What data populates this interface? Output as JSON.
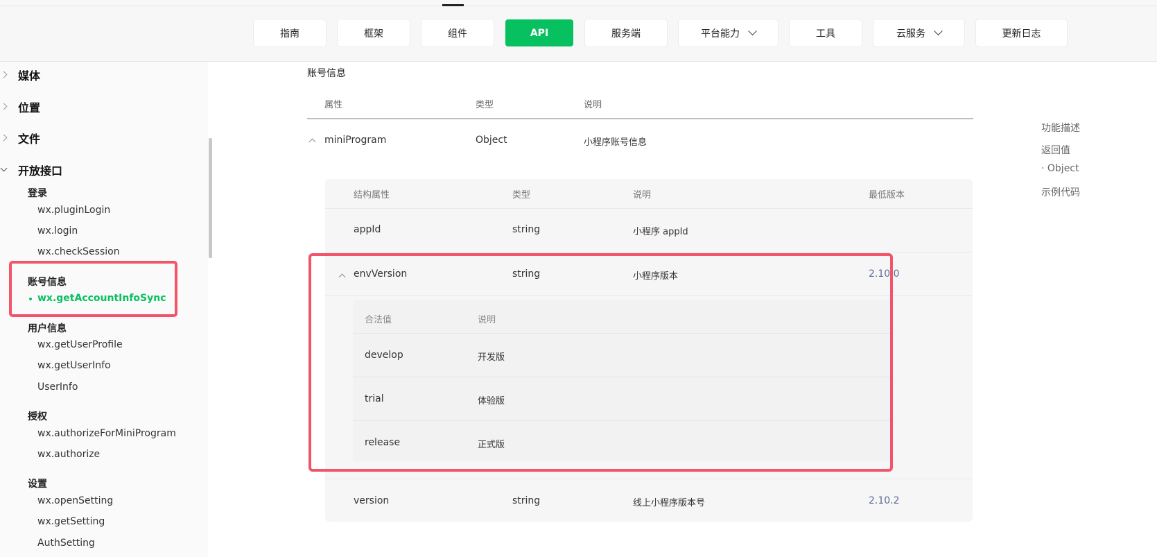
{
  "nav": {
    "items": [
      {
        "label": "指南",
        "active": false,
        "dropdown": false
      },
      {
        "label": "框架",
        "active": false,
        "dropdown": false
      },
      {
        "label": "组件",
        "active": false,
        "dropdown": false
      },
      {
        "label": "API",
        "active": true,
        "dropdown": false
      },
      {
        "label": "服务端",
        "active": false,
        "dropdown": false
      },
      {
        "label": "平台能力",
        "active": false,
        "dropdown": true
      },
      {
        "label": "工具",
        "active": false,
        "dropdown": false
      },
      {
        "label": "云服务",
        "active": false,
        "dropdown": true
      },
      {
        "label": "更新日志",
        "active": false,
        "dropdown": false
      }
    ]
  },
  "sidebar": {
    "categories": [
      {
        "label": "媒体",
        "expanded": false
      },
      {
        "label": "位置",
        "expanded": false
      },
      {
        "label": "文件",
        "expanded": false
      },
      {
        "label": "开放接口",
        "expanded": true
      }
    ],
    "groups": {
      "login": {
        "label": "登录",
        "items": [
          "wx.pluginLogin",
          "wx.login",
          "wx.checkSession"
        ]
      },
      "account": {
        "label": "账号信息",
        "items": [
          "wx.getAccountInfoSync"
        ]
      },
      "user": {
        "label": "用户信息",
        "items": [
          "wx.getUserProfile",
          "wx.getUserInfo",
          "UserInfo"
        ]
      },
      "auth": {
        "label": "授权",
        "items": [
          "wx.authorizeForMiniProgram",
          "wx.authorize"
        ]
      },
      "settings": {
        "label": "设置",
        "items": [
          "wx.openSetting",
          "wx.getSetting",
          "AuthSetting"
        ]
      }
    },
    "active_item": "wx.getAccountInfoSync"
  },
  "main": {
    "section_title": "账号信息",
    "headers": [
      "属性",
      "类型",
      "说明"
    ],
    "row": {
      "name": "miniProgram",
      "type": "Object",
      "desc": "小程序账号信息"
    },
    "sub_headers": [
      "结构属性",
      "类型",
      "说明",
      "最低版本"
    ],
    "sub_rows": [
      {
        "name": "appId",
        "type": "string",
        "desc": "小程序 appId",
        "version": ""
      },
      {
        "name": "envVersion",
        "type": "string",
        "desc": "小程序版本",
        "version": "2.10.0"
      },
      {
        "name": "version",
        "type": "string",
        "desc": "线上小程序版本号",
        "version": "2.10.2"
      }
    ],
    "enum_headers": [
      "合法值",
      "说明"
    ],
    "enum_rows": [
      {
        "value": "develop",
        "desc": "开发版"
      },
      {
        "value": "trial",
        "desc": "体验版"
      },
      {
        "value": "release",
        "desc": "正式版"
      }
    ]
  },
  "toc": [
    "功能描述",
    "返回值",
    "· Object",
    "示例代码"
  ],
  "colors": {
    "brand_green": "#07c160",
    "highlight_red": "#f0556a",
    "version_link": "#5d6c99"
  }
}
